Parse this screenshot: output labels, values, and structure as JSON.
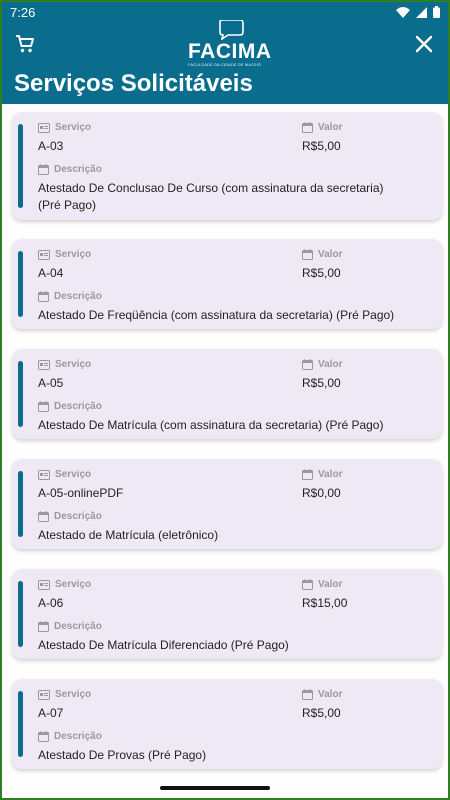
{
  "status_bar": {
    "time": "7:26"
  },
  "header": {
    "logo_text": "FACIMA",
    "logo_subtext": "FACULDADE DA CIDADE DE MACEIÓ",
    "title": "Serviços Solicitáveis",
    "cart_icon": "cart-icon",
    "close_icon": "close-icon"
  },
  "labels": {
    "servico": "Serviço",
    "valor": "Valor",
    "descricao": "Descrição"
  },
  "services": [
    {
      "code": "A-03",
      "price": "R$5,00",
      "description": "Atestado De Conclusao De Curso (com assinatura da secretaria) (Pré Pago)"
    },
    {
      "code": "A-04",
      "price": "R$5,00",
      "description": "Atestado De Freqüência (com assinatura da secretaria) (Pré Pago)"
    },
    {
      "code": "A-05",
      "price": "R$5,00",
      "description": "Atestado De Matrícula (com assinatura da secretaria) (Pré Pago)"
    },
    {
      "code": "A-05-onlinePDF",
      "price": "R$0,00",
      "description": "Atestado de Matrícula (eletrônico)"
    },
    {
      "code": "A-06",
      "price": "R$15,00",
      "description": "Atestado De Matrícula Diferenciado (Pré Pago)"
    },
    {
      "code": "A-07",
      "price": "R$5,00",
      "description": "Atestado De Provas (Pré Pago)"
    }
  ],
  "colors": {
    "brand": "#0b6d8e",
    "card_bg": "#efe9f5",
    "label_gray": "#9a9a9a"
  }
}
